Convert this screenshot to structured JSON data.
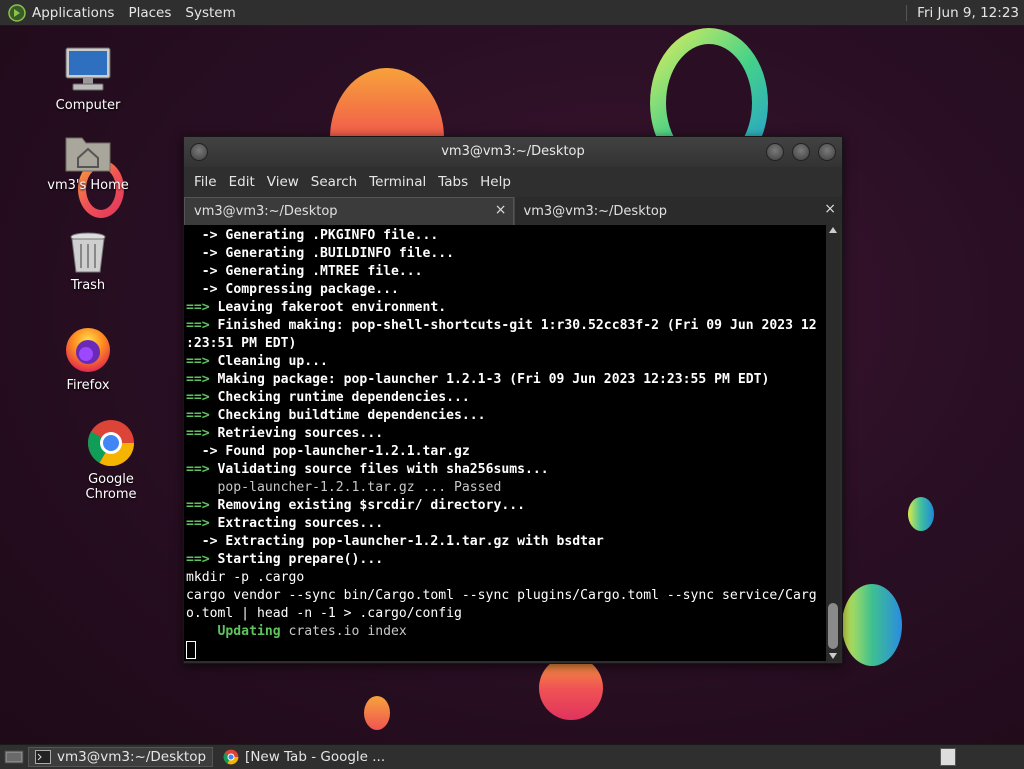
{
  "top_panel": {
    "menus": [
      "Applications",
      "Places",
      "System"
    ],
    "clock": "Fri Jun  9, 12:23"
  },
  "desktop_icons": [
    {
      "label": "Computer",
      "icon": "computer-icon"
    },
    {
      "label": "vm3's Home",
      "icon": "home-folder-icon"
    },
    {
      "label": "Trash",
      "icon": "trash-icon"
    },
    {
      "label": "Firefox",
      "icon": "firefox-icon"
    },
    {
      "label": "Google Chrome",
      "icon": "chrome-icon"
    }
  ],
  "window": {
    "title": "vm3@vm3:~/Desktop",
    "menu": [
      "File",
      "Edit",
      "View",
      "Search",
      "Terminal",
      "Tabs",
      "Help"
    ],
    "tabs": [
      {
        "label": "vm3@vm3:~/Desktop",
        "active": true
      },
      {
        "label": "vm3@vm3:~/Desktop",
        "active": false
      }
    ],
    "close_glyph": "×"
  },
  "terminal": {
    "lines": [
      {
        "prefix": "  ->",
        "text": " Generating .PKGINFO file...",
        "style": "arrow"
      },
      {
        "prefix": "  ->",
        "text": " Generating .BUILDINFO file...",
        "style": "arrow"
      },
      {
        "prefix": "  ->",
        "text": " Generating .MTREE file...",
        "style": "arrow"
      },
      {
        "prefix": "  ->",
        "text": " Compressing package...",
        "style": "arrow"
      },
      {
        "prefix": "==>",
        "text": " Leaving fakeroot environment.",
        "style": "step"
      },
      {
        "prefix": "==>",
        "text": " Finished making: pop-shell-shortcuts-git 1:r30.52cc83f-2 (Fri 09 Jun 2023 12",
        "style": "step"
      },
      {
        "prefix": "",
        "text": ":23:51 PM EDT)",
        "style": "bold"
      },
      {
        "prefix": "==>",
        "text": " Cleaning up...",
        "style": "step"
      },
      {
        "prefix": "==>",
        "text": " Making package: pop-launcher 1.2.1-3 (Fri 09 Jun 2023 12:23:55 PM EDT)",
        "style": "step"
      },
      {
        "prefix": "==>",
        "text": " Checking runtime dependencies...",
        "style": "step"
      },
      {
        "prefix": "==>",
        "text": " Checking buildtime dependencies...",
        "style": "step"
      },
      {
        "prefix": "==>",
        "text": " Retrieving sources...",
        "style": "step"
      },
      {
        "prefix": "  ->",
        "text": " Found pop-launcher-1.2.1.tar.gz",
        "style": "arrow"
      },
      {
        "prefix": "==>",
        "text": " Validating source files with sha256sums...",
        "style": "step"
      },
      {
        "prefix": "",
        "text": "    pop-launcher-1.2.1.tar.gz ... Passed",
        "style": "plain"
      },
      {
        "prefix": "==>",
        "text": " Removing existing $srcdir/ directory...",
        "style": "step"
      },
      {
        "prefix": "==>",
        "text": " Extracting sources...",
        "style": "step"
      },
      {
        "prefix": "  ->",
        "text": " Extracting pop-launcher-1.2.1.tar.gz with bsdtar",
        "style": "arrow"
      },
      {
        "prefix": "==>",
        "text": " Starting prepare()...",
        "style": "step"
      },
      {
        "prefix": "",
        "text": "mkdir -p .cargo",
        "style": "cmd"
      },
      {
        "prefix": "",
        "text": "cargo vendor --sync bin/Cargo.toml --sync plugins/Cargo.toml --sync service/Carg",
        "style": "cmd"
      },
      {
        "prefix": "",
        "text": "o.toml | head -n -1 > .cargo/config",
        "style": "cmd"
      },
      {
        "prefix": "    Updating",
        "text": " crates.io index",
        "style": "updating"
      }
    ]
  },
  "taskbar": {
    "tasks": [
      {
        "label": "vm3@vm3:~/Desktop",
        "icon": "terminal-icon",
        "active": true
      },
      {
        "label": "[New Tab - Google ...",
        "icon": "chrome-icon",
        "active": false
      }
    ]
  }
}
